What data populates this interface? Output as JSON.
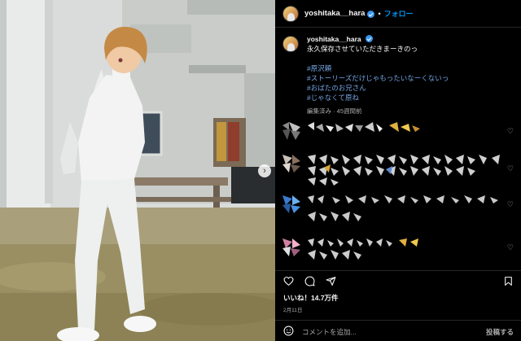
{
  "post": {
    "username": "yoshitaka__hara",
    "follow_label": "フォロー",
    "separator": "•",
    "caption": "永久保存させていただきまーきのっ",
    "hashtags": [
      "#原沢頼",
      "#ストーリーズだけじゃもったいなーくないっ",
      "#おばたのお兄さん",
      "#じゃなくて原ね"
    ],
    "meta": "編集済み · 45週間前",
    "likes": "いいね！14.7万件",
    "date": "2月11日"
  },
  "comment_box": {
    "placeholder": "コメントを追加...",
    "post_label": "投稿する"
  },
  "icons": {
    "verified": "verified-badge-icon",
    "heart": "heart-icon",
    "comment": "comment-icon",
    "share": "share-icon",
    "bookmark": "bookmark-icon",
    "emoji": "emoji-icon",
    "next": "chevron-right-icon"
  },
  "colors": {
    "accent": "#0095f6",
    "hashtag": "#74a7e6",
    "background": "#000000"
  }
}
